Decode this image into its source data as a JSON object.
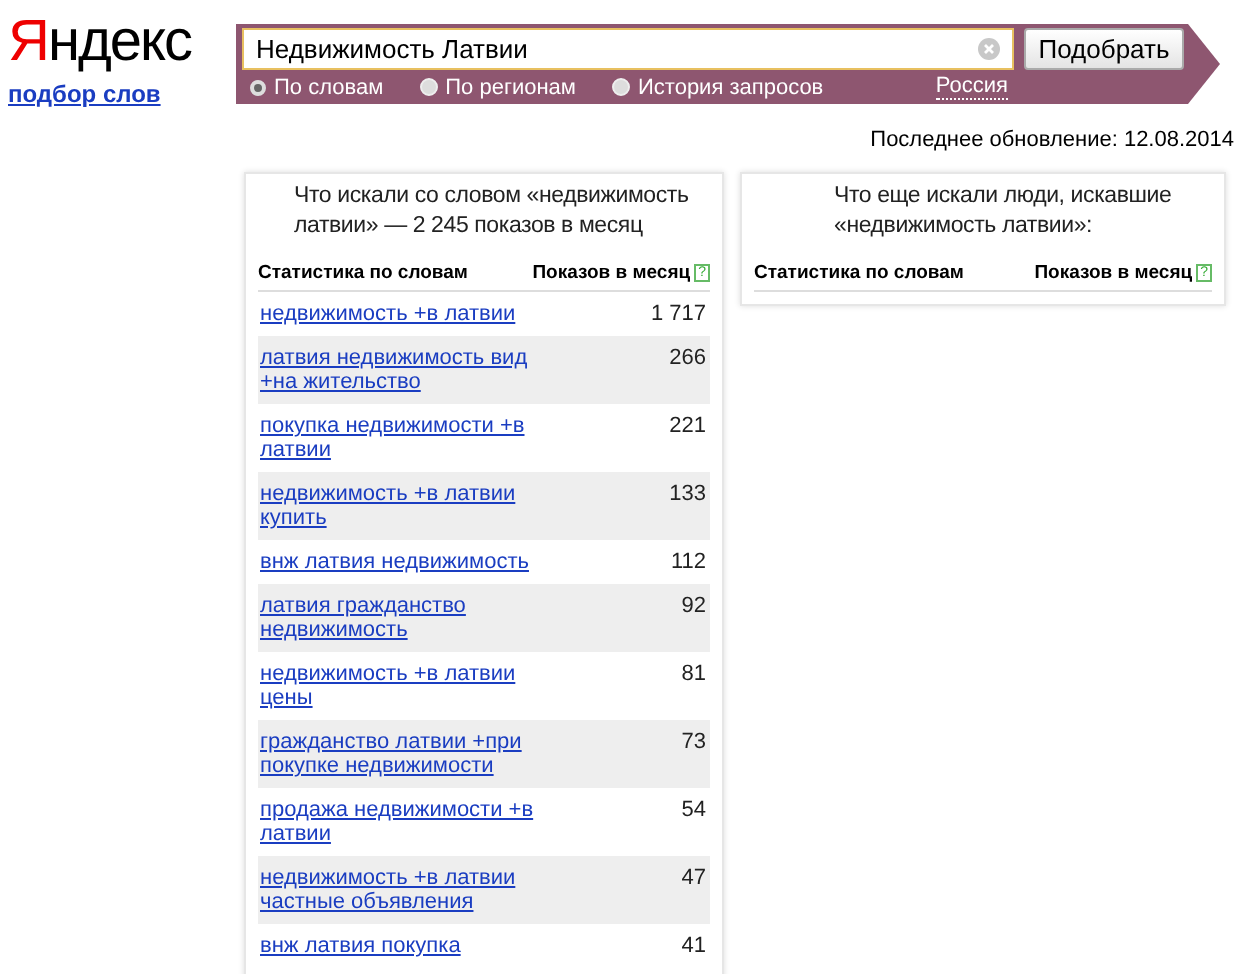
{
  "logo": {
    "text": "Яндекс",
    "subtitle": "подбор слов"
  },
  "search": {
    "value": "Недвижимость Латвии",
    "button": "Подобрать",
    "modes": [
      {
        "label": "По словам",
        "selected": true
      },
      {
        "label": "По регионам",
        "selected": false
      },
      {
        "label": "История запросов",
        "selected": false
      }
    ],
    "region": "Россия"
  },
  "last_update": "Последнее обновление: 12.08.2014",
  "left_panel": {
    "title": "Что искали со словом «недвижимость латвии» — 2 245 показов в месяц",
    "columns": [
      "Статистика по словам",
      "Показов в месяц"
    ],
    "help": "?",
    "rows": [
      {
        "phrase": "недвижимость +в латвии",
        "count": "1 717"
      },
      {
        "phrase": "латвия недвижимость вид +на жительство",
        "count": "266"
      },
      {
        "phrase": "покупка недвижимости +в латвии",
        "count": "221"
      },
      {
        "phrase": "недвижимость +в латвии купить",
        "count": "133"
      },
      {
        "phrase": "внж латвия недвижимость",
        "count": "112"
      },
      {
        "phrase": "латвия гражданство недвижимость",
        "count": "92"
      },
      {
        "phrase": "недвижимость +в латвии цены",
        "count": "81"
      },
      {
        "phrase": "гражданство латвии +при покупке недвижимости",
        "count": "73"
      },
      {
        "phrase": "продажа недвижимости +в латвии",
        "count": "54"
      },
      {
        "phrase": "недвижимость +в латвии частные объявления",
        "count": "47"
      },
      {
        "phrase": "внж латвия покупка",
        "count": "41"
      }
    ]
  },
  "right_panel": {
    "title": "Что еще искали люди, искавшие «недвижимость латвии»:",
    "columns": [
      "Статистика по словам",
      "Показов в месяц"
    ],
    "help": "?"
  }
}
